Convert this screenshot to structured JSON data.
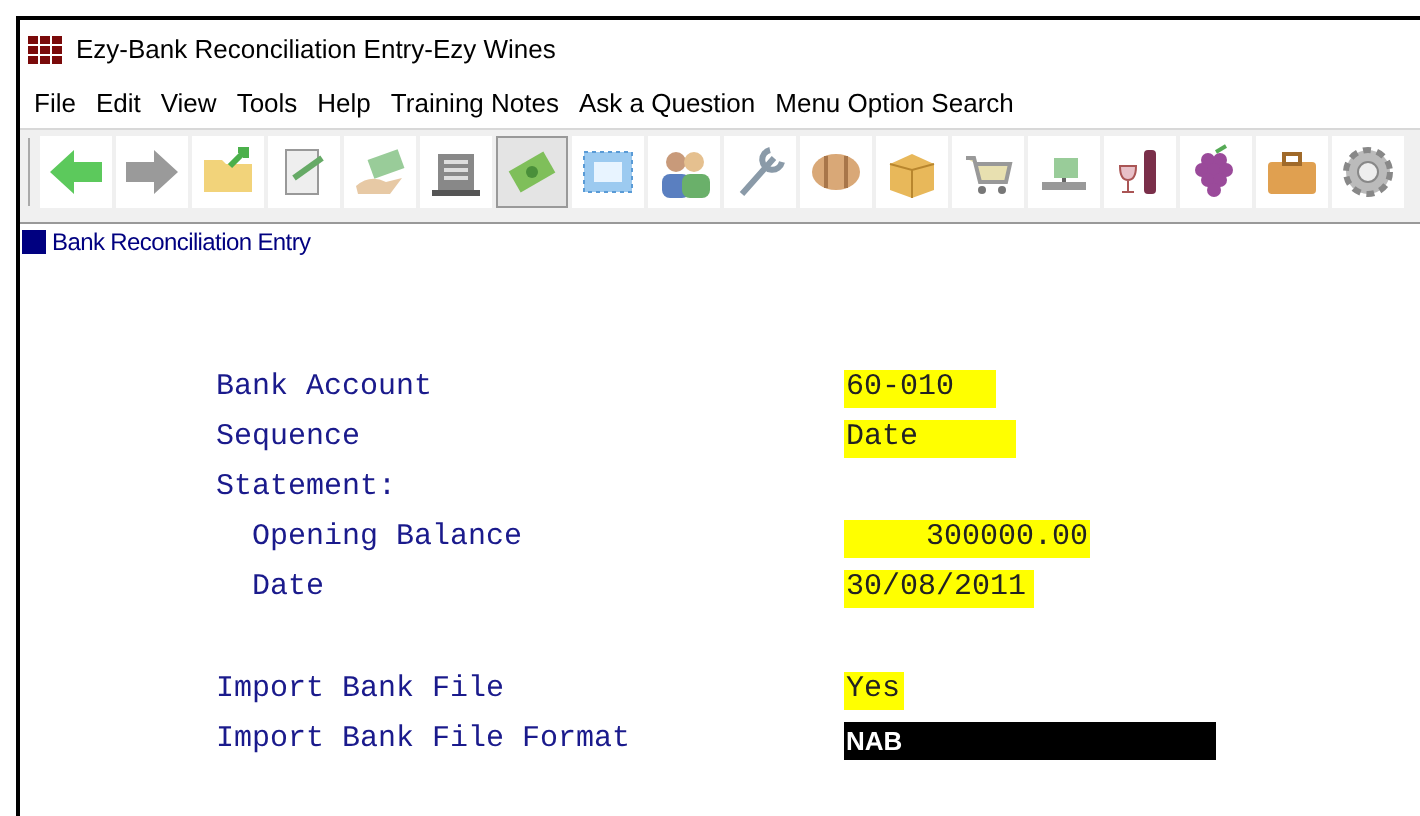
{
  "window": {
    "title": "Ezy-Bank Reconciliation Entry-Ezy Wines"
  },
  "menu": [
    "File",
    "Edit",
    "View",
    "Tools",
    "Help",
    "Training Notes",
    "Ask a Question",
    "Menu Option Search"
  ],
  "toolbar": [
    {
      "selected": false
    },
    {
      "selected": false
    },
    {
      "selected": false
    },
    {
      "selected": false
    },
    {
      "selected": false
    },
    {
      "selected": false
    },
    {
      "selected": true
    },
    {
      "selected": false
    },
    {
      "selected": false
    },
    {
      "selected": false
    },
    {
      "selected": false
    },
    {
      "selected": false
    },
    {
      "selected": false
    },
    {
      "selected": false
    },
    {
      "selected": false
    },
    {
      "selected": false
    },
    {
      "selected": false
    },
    {
      "selected": false
    }
  ],
  "form_title": "Bank Reconciliation Entry",
  "fields": [
    {
      "label": "Bank Account",
      "value": "60-010",
      "focused": false
    },
    {
      "label": "Sequence",
      "value": "Date",
      "focused": false
    },
    {
      "kind": "heading",
      "label": "Statement:",
      "children": [
        {
          "label": "Opening Balance",
          "value": "300000.00",
          "focused": false,
          "kind": "amount"
        },
        {
          "label": "Date",
          "value": "30/08/2011",
          "focused": false
        }
      ]
    },
    {
      "kind": "spacer"
    },
    {
      "label": "Import Bank File",
      "value": "Yes",
      "focused": false
    },
    {
      "label": "Import Bank File Format",
      "value": "NAB",
      "focused": true
    }
  ]
}
